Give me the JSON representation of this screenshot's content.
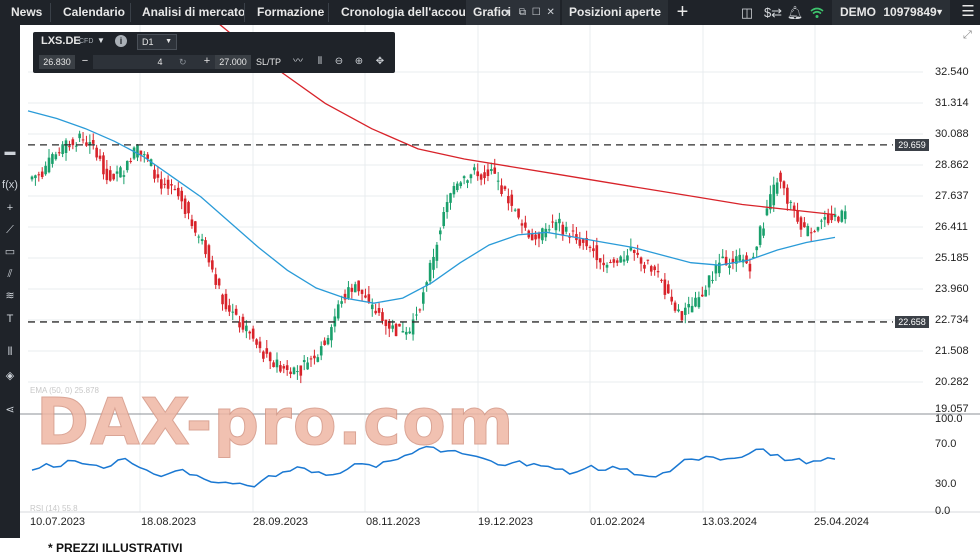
{
  "nav": {
    "items": [
      "News",
      "Calendario",
      "Analisi di mercato",
      "Formazione",
      "Cronologia dell'account"
    ],
    "active_tab": "Grafici",
    "second_tab": "Posizioni aperte",
    "add_tab_symbol": "+",
    "account_label": "DEMO",
    "account_number": "10979849"
  },
  "instrument": {
    "symbol": "LXS.DE",
    "type": "CFD",
    "timeframe": "D1",
    "bid": "26.830",
    "quantity": "4",
    "ask": "27.000",
    "sltp_label": "SL/TP"
  },
  "price_axis": {
    "ticks": [
      "32.540",
      "31.314",
      "30.088",
      "28.862",
      "27.637",
      "26.411",
      "25.185",
      "23.960",
      "22.734",
      "21.508",
      "20.282",
      "19.057"
    ]
  },
  "indicator_axis": {
    "ticks": [
      "100.0",
      "70.0",
      "30.0",
      "0.0"
    ]
  },
  "horizontal_lines": {
    "resistance": "29.659",
    "support": "22.658"
  },
  "x_axis": {
    "ticks": [
      "10.07.2023",
      "18.08.2023",
      "28.09.2023",
      "08.11.2023",
      "19.12.2023",
      "01.02.2024",
      "13.03.2024",
      "25.04.2024"
    ]
  },
  "indicator_labels": {
    "ema": "EMA (50, 0) 25.878",
    "rsi": "RSI (14) 55.8"
  },
  "watermark": "DAX-pro.com",
  "footer": "* PREZZI ILLUSTRATIVI",
  "colors": {
    "bull": "#1aa06c",
    "bear": "#d8232a",
    "ema_fast": "#2a9bd8",
    "ema_slow": "#d8232a",
    "rsi": "#1a78d2"
  },
  "chart_data": {
    "type": "candlestick",
    "title": "",
    "xlabel": "",
    "ylabel": "",
    "x": [
      "10.07.2023",
      "18.08.2023",
      "28.09.2023",
      "08.11.2023",
      "19.12.2023",
      "01.02.2024",
      "13.03.2024",
      "25.04.2024"
    ],
    "ylim": [
      19.057,
      33.2
    ],
    "series": [
      {
        "name": "",
        "type": "close",
        "values": [
          28.6,
          29.2,
          29.7,
          29.9,
          29.4,
          28.2,
          28.7,
          29.6,
          28.9,
          27.9,
          27.6,
          26.6,
          25.5,
          23.9,
          23.0,
          22.3,
          21.5,
          21.0,
          20.9,
          20.7,
          21.4,
          22.2,
          23.6,
          24.2,
          23.3,
          22.9,
          22.3,
          22.4,
          23.7,
          25.8,
          27.7,
          28.5,
          28.6,
          28.5,
          27.7,
          26.7,
          26.0,
          26.3,
          26.5,
          26.1,
          25.7,
          25.2,
          25.0,
          25.3,
          25.1,
          24.7,
          23.6,
          22.8,
          23.4,
          24.4,
          25.2,
          25.1,
          24.9,
          26.6,
          28.3,
          27.2,
          26.3,
          26.5,
          26.7,
          26.9
        ]
      },
      {
        "name": "",
        "type": "ema",
        "values": [
          31.0,
          30.7,
          30.3,
          29.8,
          29.2,
          28.4,
          27.6,
          26.6,
          25.6,
          24.7,
          24.0,
          23.6,
          23.4,
          23.6,
          24.2,
          25.0,
          25.7,
          26.1,
          26.2,
          26.0,
          25.8,
          25.6,
          25.3,
          25.0,
          24.9,
          25.1,
          25.5,
          25.8,
          26.0
        ]
      },
      {
        "name": "",
        "type": "ema",
        "values": [
          37.0,
          35.5,
          34.0,
          32.6,
          31.3,
          30.3,
          29.5,
          29.1,
          28.8,
          28.5,
          28.2,
          27.9,
          27.6,
          27.3,
          27.1,
          26.9
        ]
      },
      {
        "name": "",
        "type": "rsi",
        "values": [
          45,
          52,
          49,
          55,
          51,
          47,
          56,
          52,
          45,
          38,
          44,
          40,
          35,
          31,
          30,
          28,
          33,
          38,
          44,
          47,
          43,
          40,
          46,
          52,
          48,
          55,
          61,
          68,
          70,
          66,
          63,
          60,
          55,
          50,
          55,
          52,
          49,
          46,
          43,
          50,
          45,
          46,
          40,
          38,
          42,
          50,
          57,
          60,
          56,
          58,
          63,
          68,
          62,
          56,
          52,
          55,
          57
        ]
      }
    ],
    "horizontal_levels": [
      29.659,
      22.658
    ],
    "indicator_ylim": [
      0,
      100
    ],
    "grid": true
  }
}
